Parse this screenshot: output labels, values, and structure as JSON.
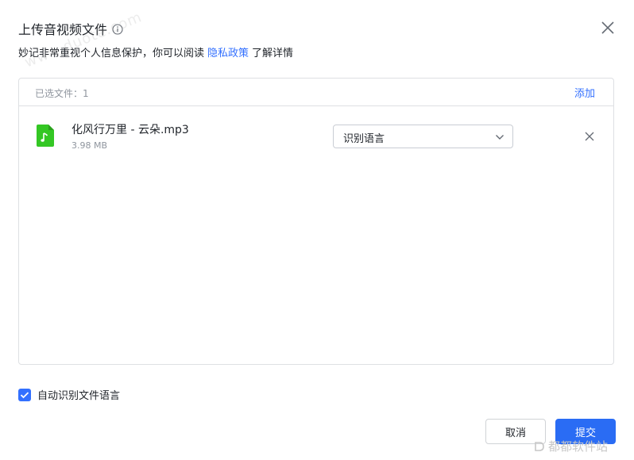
{
  "dialog": {
    "title": "上传音视频文件",
    "info_icon": "info-circle-icon",
    "close_icon": "close-icon",
    "subtitle_prefix": "妙记非常重视个人信息保护，你可以阅读",
    "privacy_link": "隐私政策",
    "subtitle_suffix": "了解详情"
  },
  "panel": {
    "selected_label": "已选文件：1",
    "add_label": "添加",
    "files": [
      {
        "name": "化风行万里 - 云朵.mp3",
        "size": "3.98 MB",
        "icon": "audio-file-icon",
        "language_select": "识别语言"
      }
    ]
  },
  "auto_detect": {
    "checked": true,
    "label": "自动识别文件语言"
  },
  "footer": {
    "cancel_label": "取消",
    "submit_label": "提交"
  },
  "watermarks": {
    "top": "www.duote.com",
    "bottom_right": "都都软件站"
  },
  "colors": {
    "accent": "#3370ff",
    "submit": "#2a6cf4",
    "file_icon": "#34c724",
    "border": "#dee0e3"
  }
}
